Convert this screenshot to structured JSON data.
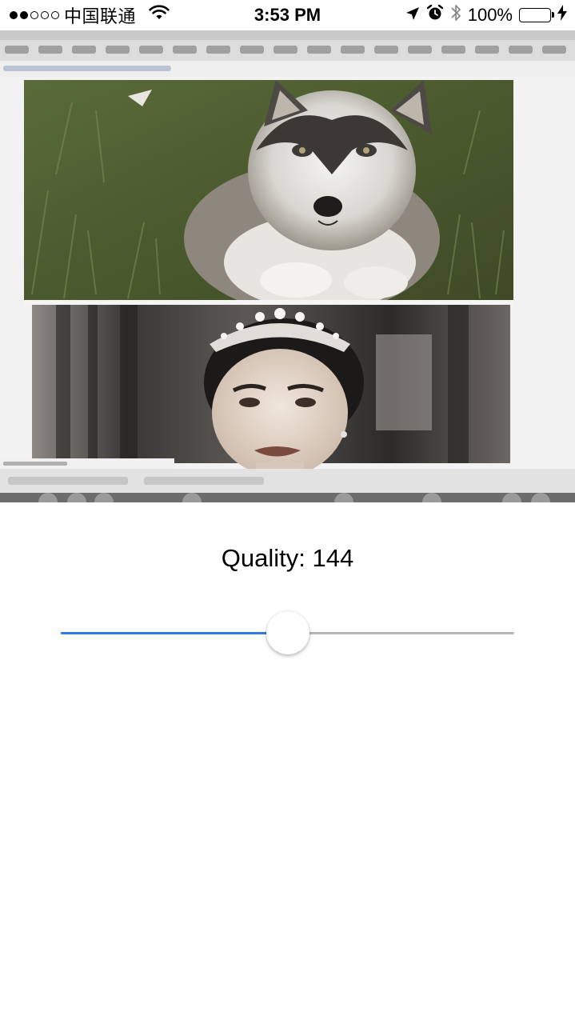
{
  "status_bar": {
    "signal_strength": 2,
    "signal_total": 5,
    "carrier": "中国联通",
    "time": "3:53 PM",
    "battery_percent": "100%",
    "battery_color": "#4cd964",
    "icons": [
      "wifi-icon",
      "location-arrow-icon",
      "alarm-icon",
      "bluetooth-icon",
      "battery-icon",
      "charging-bolt-icon"
    ]
  },
  "camera_preview": {
    "description_icons": [
      "husky-puppy-photo",
      "woman-with-tiara-photo"
    ]
  },
  "quality": {
    "label": "Quality: 144",
    "slider_fraction": 0.5,
    "fill_color": "#2f7ae5",
    "track_color": "#b7b7b7"
  }
}
